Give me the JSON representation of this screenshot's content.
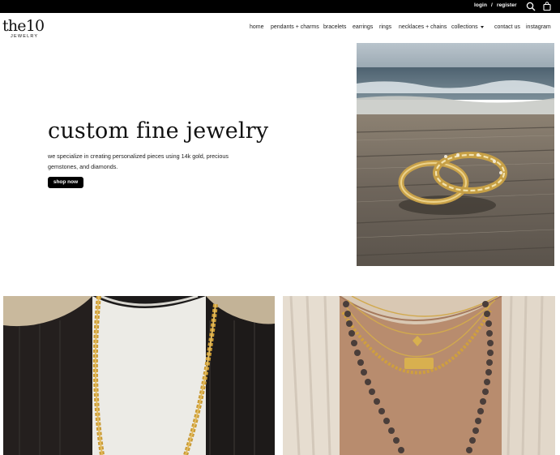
{
  "topbar": {
    "login_label": "login",
    "separator": "/",
    "register_label": "register",
    "search_icon": "search-icon",
    "cart_icon": "bag-icon"
  },
  "brand": {
    "logo_word": "the10",
    "logo_sub": "JEWELRY"
  },
  "nav": {
    "items": [
      {
        "label": "home"
      },
      {
        "label": "pendants + charms"
      },
      {
        "label": "bracelets"
      },
      {
        "label": "earrings"
      },
      {
        "label": "rings"
      },
      {
        "label": "necklaces + chains"
      },
      {
        "label": "collections",
        "has_dropdown": true
      },
      {
        "label": "contact us"
      },
      {
        "label": "instagram"
      }
    ]
  },
  "hero": {
    "title": "custom fine jewelry",
    "subtitle": "we specialize in creating personalized pieces using 14k gold, precious gemstones, and diamonds.",
    "cta_label": "shop now"
  },
  "colors": {
    "topbar_bg": "#000000",
    "button_bg": "#000000",
    "text": "#111111"
  }
}
